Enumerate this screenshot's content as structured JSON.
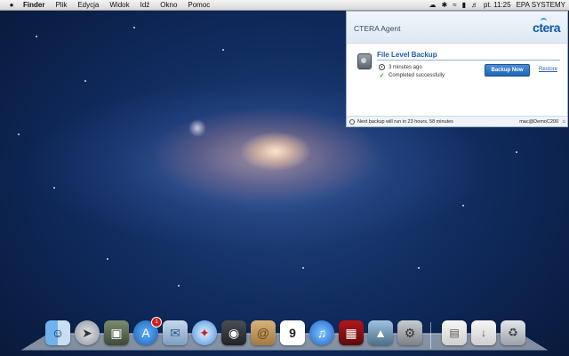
{
  "menubar": {
    "apple": "",
    "app": "Finder",
    "items": [
      "Plik",
      "Edycja",
      "Widok",
      "Idź",
      "Okno",
      "Pomoc"
    ],
    "right": {
      "time": "pt. 11:25",
      "user": "EPA SYSTEMY",
      "status_icons": [
        "cloud-icon",
        "bluetooth-icon",
        "wifi-icon",
        "battery-icon",
        "volume-icon"
      ]
    }
  },
  "ctera": {
    "title": "CTERA Agent",
    "logo": "ctera",
    "section_title": "File Level Backup",
    "last_backup": "3 minutes ago",
    "status": "Completed successfully",
    "backup_now": "Backup Now",
    "restore": "Restore",
    "footer_text": "Next backup will run in 23 hours, 58 minutes",
    "footer_user": "mac@DemoC200"
  },
  "dock": {
    "items": [
      {
        "name": "finder"
      },
      {
        "name": "launchpad"
      },
      {
        "name": "mission-control"
      },
      {
        "name": "app-store",
        "badge": "1"
      },
      {
        "name": "mail"
      },
      {
        "name": "safari"
      },
      {
        "name": "facetime"
      },
      {
        "name": "address-book"
      },
      {
        "name": "ical",
        "date": "9"
      },
      {
        "name": "itunes"
      },
      {
        "name": "photo-booth"
      },
      {
        "name": "iphoto"
      },
      {
        "name": "system-preferences"
      },
      {
        "name": "documents"
      },
      {
        "name": "downloads"
      },
      {
        "name": "trash"
      }
    ]
  },
  "colors": {
    "accent": "#1f63b5",
    "link": "#2a5db0",
    "success": "#2c9a2c",
    "section_title": "#1a5ea8"
  }
}
